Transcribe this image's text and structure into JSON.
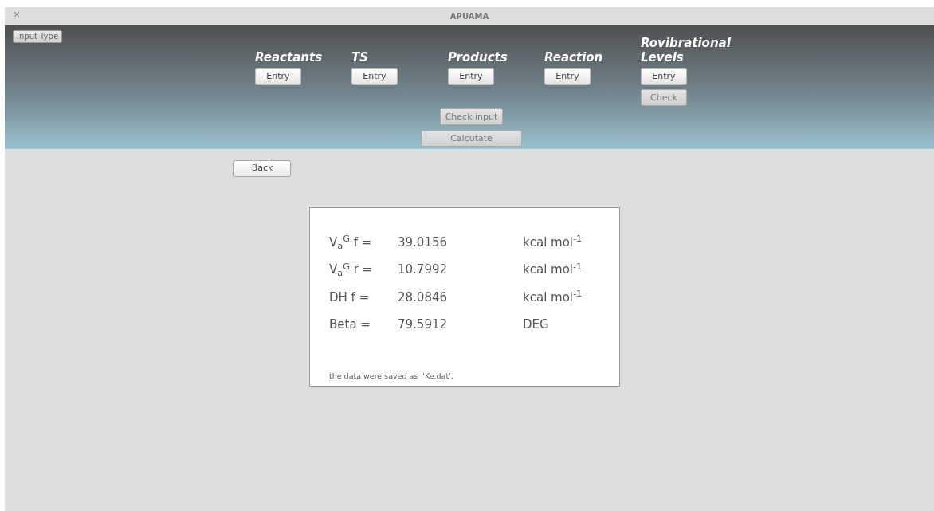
{
  "window": {
    "title": "APUAMA",
    "close": "×"
  },
  "input_type_button": {
    "label": "Input Type"
  },
  "sections": [
    {
      "title": "Reactants",
      "buttons": [
        {
          "label": "Entry",
          "disabled": false
        }
      ]
    },
    {
      "title": "TS",
      "buttons": [
        {
          "label": "Entry",
          "disabled": false
        }
      ]
    },
    {
      "title": "Products",
      "buttons": [
        {
          "label": "Entry",
          "disabled": false
        }
      ]
    },
    {
      "title": "Reaction",
      "buttons": [
        {
          "label": "Entry",
          "disabled": false
        }
      ]
    },
    {
      "title": "Rovibrational Levels",
      "buttons": [
        {
          "label": "Entry",
          "disabled": false
        },
        {
          "label": "Check",
          "disabled": true
        }
      ]
    }
  ],
  "actions": [
    {
      "label": "Check input",
      "disabled": true
    },
    {
      "label": "Calcutate",
      "disabled": true
    }
  ],
  "back_button": {
    "label": "Back"
  },
  "results": {
    "rows": [
      {
        "label": "V$_{a}$$^{G}$ f =",
        "value": "39.0156",
        "unit": "kcal mol$^{-1}$"
      },
      {
        "label": "V$_{a}$$^{G}$ r =",
        "value": "10.7992",
        "unit": "kcal mol$^{-1}$"
      },
      {
        "label": "DH f =",
        "value": "28.0846",
        "unit": "kcal mol$^{-1}$"
      },
      {
        "label": "Beta =",
        "value": "79.5912",
        "unit": "DEG"
      }
    ],
    "note": "the data were saved as  'Ke.dat'."
  }
}
